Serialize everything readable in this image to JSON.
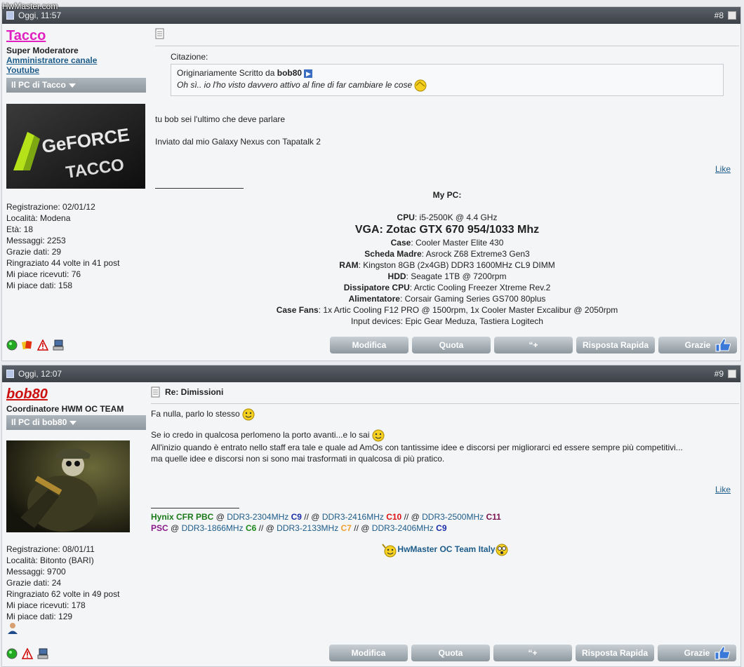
{
  "watermark": "HwMaster.com",
  "posts": [
    {
      "date": "Oggi, 11:57",
      "number": "#8",
      "username": "Tacco",
      "username_color": "#e020c0",
      "role": "Super Moderatore",
      "extra_links": [
        "Amministratore canale",
        "Youtube"
      ],
      "pc_label": "Il PC di Tacco",
      "avatar_text": "GeFORCE TACCO",
      "stats": [
        "Registrazione: 02/01/12",
        "Località: Modena",
        "Età: 18",
        "Messaggi: 2253",
        "Grazie dati: 29",
        "Ringraziato 44 volte in 41 post",
        "Mi piace ricevuti: 76",
        "Mi piace dati: 158"
      ],
      "quote_label": "Citazione:",
      "quote_author_prefix": "Originariamente Scritto da",
      "quote_author": "bob80",
      "quote_text": "Oh sì.. io l'ho visto davvero attivo al fine di far cambiare le cose",
      "body": [
        "tu bob sei l'ultimo che deve parlare",
        "Inviato dal mio Galaxy Nexus con Tapatalk 2"
      ],
      "like": "Like",
      "sig": {
        "title": "My PC:",
        "cpu_label": "CPU",
        "cpu": "i5-2500K @ 4.4 GHz",
        "vga": "VGA: Zotac GTX 670 954/1033 Mhz",
        "case_label": "Case",
        "case": "Cooler Master Elite 430",
        "mb_label": "Scheda Madre",
        "mb": "Asrock Z68 Extreme3 Gen3",
        "ram_label": "RAM",
        "ram": "Kingston 8GB (2x4GB) DDR3 1600MHz CL9 DIMM",
        "hdd_label": "HDD",
        "hdd": "Seagate 1TB @ 7200rpm",
        "cool_label": "Dissipatore CPU",
        "cool": "Arctic Cooling Freezer Xtreme Rev.2",
        "psu_label": "Alimentatore",
        "psu": "Corsair Gaming Series GS700 80plus",
        "fans_label": "Case Fans",
        "fans": "1x Artic Cooling F12 PRO @ 1500rpm, 1x Cooler Master Excalibur @ 2050rpm",
        "input": "Input devices: Epic Gear Meduza, Tastiera Logitech"
      },
      "buttons": [
        "Modifica",
        "Quota",
        "“+",
        "Risposta Rapida",
        "Grazie"
      ]
    },
    {
      "date": "Oggi, 12:07",
      "number": "#9",
      "username": "bob80",
      "username_color": "#cc1111",
      "role": "Coordinatore HWM OC TEAM",
      "pc_label": "Il PC di bob80",
      "stats": [
        "Registrazione: 08/01/11",
        "Località: Bitonto (BARI)",
        "Messaggi: 9700",
        "Grazie dati: 24",
        "Ringraziato 62 volte in 49 post",
        "Mi piace ricevuti: 178",
        "Mi piace dati: 129"
      ],
      "title": "Re: Dimissioni",
      "body": [
        "Fa nulla, parlo lo stesso",
        "Se io credo in qualcosa perlomeno la porto avanti...e lo sai",
        "All'inizio quando è entrato nello staff era tale e quale ad AmOs con tantissime idee e discorsi per migliorarci ed essere sempre più competitivi...",
        "ma quelle idee e discorsi non si sono mai trasformati in qualcosa di più pratico."
      ],
      "like": "Like",
      "sig": {
        "hynix": "Hynix CFR PBC",
        "at": "@",
        "sep": "//",
        "r1": "DDR3-2304MHz",
        "c1": "C9",
        "r2": "DDR3-2416MHz",
        "c2": "C10",
        "r3": "DDR3-2500MHz",
        "c3": "C11",
        "psc": "PSC",
        "r4": "DDR3-1866MHz",
        "c4": "C6",
        "r5": "DDR3-2133MHz",
        "c5": "C7",
        "r6": "DDR3-2406MHz",
        "c6": "C9",
        "team": "HwMaster OC Team Italy"
      },
      "buttons": [
        "Modifica",
        "Quota",
        "“+",
        "Risposta Rapida",
        "Grazie"
      ]
    }
  ]
}
